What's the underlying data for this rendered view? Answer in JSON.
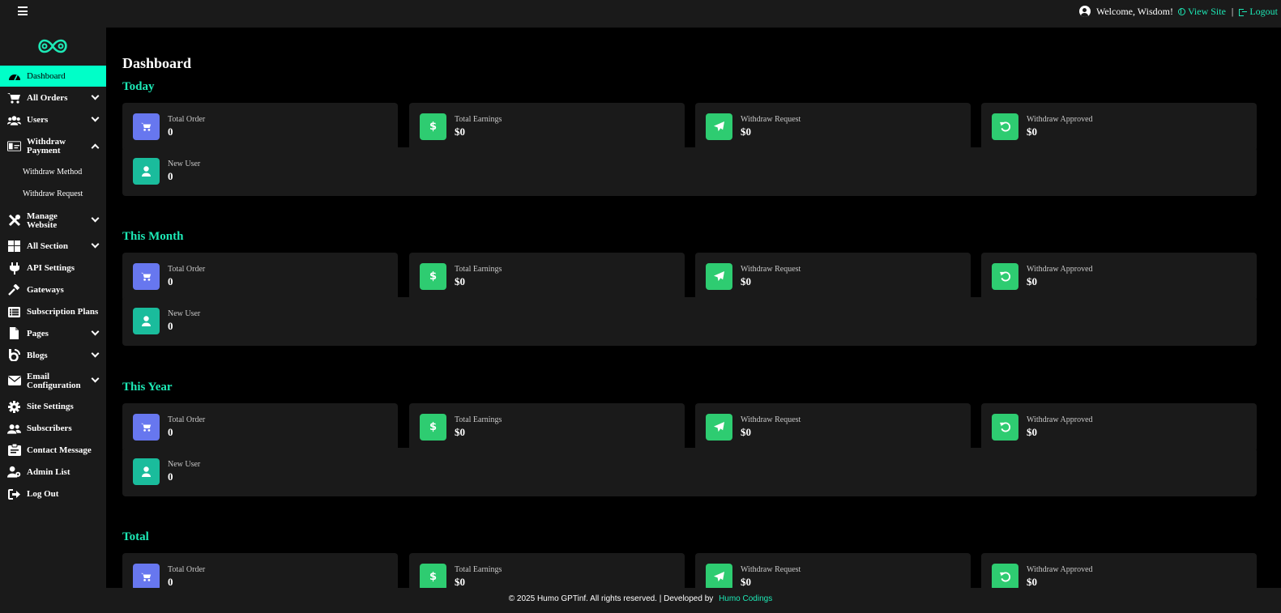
{
  "topbar": {
    "welcome": "Welcome, Wisdom!",
    "view_site": "View Site",
    "separator": "|",
    "logout": "Logout"
  },
  "sidebar": {
    "items": [
      {
        "label": "Dashboard",
        "icon": "gauge-icon",
        "active": true
      },
      {
        "label": "All Orders",
        "icon": "cart-icon",
        "chevron": "down"
      },
      {
        "label": "Users",
        "icon": "users-icon",
        "chevron": "down"
      },
      {
        "label": "Withdraw Payment",
        "icon": "money-icon",
        "chevron": "up"
      },
      {
        "label": "Manage Website",
        "icon": "tools-icon",
        "chevron": "down"
      },
      {
        "label": "All Section",
        "icon": "grid-icon",
        "chevron": "down"
      },
      {
        "label": "API Settings",
        "icon": "plug-icon"
      },
      {
        "label": "Gateways",
        "icon": "gavel-icon"
      },
      {
        "label": "Subscription Plans",
        "icon": "list-icon"
      },
      {
        "label": "Pages",
        "icon": "file-icon",
        "chevron": "down"
      },
      {
        "label": "Blogs",
        "icon": "blog-icon",
        "chevron": "down"
      },
      {
        "label": "Email Configuration",
        "icon": "envelope-icon",
        "chevron": "down"
      },
      {
        "label": "Site Settings",
        "icon": "gear-icon"
      },
      {
        "label": "Subscribers",
        "icon": "users-icon"
      },
      {
        "label": "Contact Message",
        "icon": "clipboard-icon"
      },
      {
        "label": "Admin List",
        "icon": "user-gear-icon"
      },
      {
        "label": "Log Out",
        "icon": "logout-icon"
      }
    ],
    "withdraw_sub": [
      "Withdraw Method",
      "Withdraw Request"
    ]
  },
  "main": {
    "title": "Dashboard",
    "sections": [
      {
        "title": "Today",
        "cards": [
          {
            "label": "Total Order",
            "value": "0",
            "color": "#6777ef",
            "icon": "cart-icon"
          },
          {
            "label": "Total Earnings",
            "value": "$0",
            "color": "#2ecc71",
            "icon": "dollar-icon"
          },
          {
            "label": "Withdraw Request",
            "value": "$0",
            "color": "#2ecc71",
            "icon": "paper-plane-icon"
          },
          {
            "label": "Withdraw Approved",
            "value": "$0",
            "color": "#2ecc71",
            "icon": "undo-icon"
          },
          {
            "label": "New User",
            "value": "0",
            "color": "#1abc9c",
            "icon": "user-icon"
          }
        ]
      },
      {
        "title": "This Month",
        "cards": [
          {
            "label": "Total Order",
            "value": "0",
            "color": "#6777ef",
            "icon": "cart-icon"
          },
          {
            "label": "Total Earnings",
            "value": "$0",
            "color": "#2ecc71",
            "icon": "dollar-icon"
          },
          {
            "label": "Withdraw Request",
            "value": "$0",
            "color": "#2ecc71",
            "icon": "paper-plane-icon"
          },
          {
            "label": "Withdraw Approved",
            "value": "$0",
            "color": "#2ecc71",
            "icon": "undo-icon"
          },
          {
            "label": "New User",
            "value": "0",
            "color": "#1abc9c",
            "icon": "user-icon"
          }
        ]
      },
      {
        "title": "This Year",
        "cards": [
          {
            "label": "Total Order",
            "value": "0",
            "color": "#6777ef",
            "icon": "cart-icon"
          },
          {
            "label": "Total Earnings",
            "value": "$0",
            "color": "#2ecc71",
            "icon": "dollar-icon"
          },
          {
            "label": "Withdraw Request",
            "value": "$0",
            "color": "#2ecc71",
            "icon": "paper-plane-icon"
          },
          {
            "label": "Withdraw Approved",
            "value": "$0",
            "color": "#2ecc71",
            "icon": "undo-icon"
          },
          {
            "label": "New User",
            "value": "0",
            "color": "#1abc9c",
            "icon": "user-icon"
          }
        ]
      },
      {
        "title": "Total",
        "cards": [
          {
            "label": "Total Order",
            "value": "0",
            "color": "#6777ef",
            "icon": "cart-icon"
          },
          {
            "label": "Total Earnings",
            "value": "$0",
            "color": "#2ecc71",
            "icon": "dollar-icon"
          },
          {
            "label": "Withdraw Request",
            "value": "$0",
            "color": "#2ecc71",
            "icon": "paper-plane-icon"
          },
          {
            "label": "Withdraw Approved",
            "value": "$0",
            "color": "#2ecc71",
            "icon": "undo-icon"
          }
        ]
      }
    ]
  },
  "footer": {
    "text": "© 2025 Humo GPTinf. All rights reserved. | Developed by",
    "link": "Humo Codings"
  },
  "colors": {
    "accent": "#1de9b6",
    "active_nav": "#00ffc8",
    "panel": "#1a1a1a"
  }
}
